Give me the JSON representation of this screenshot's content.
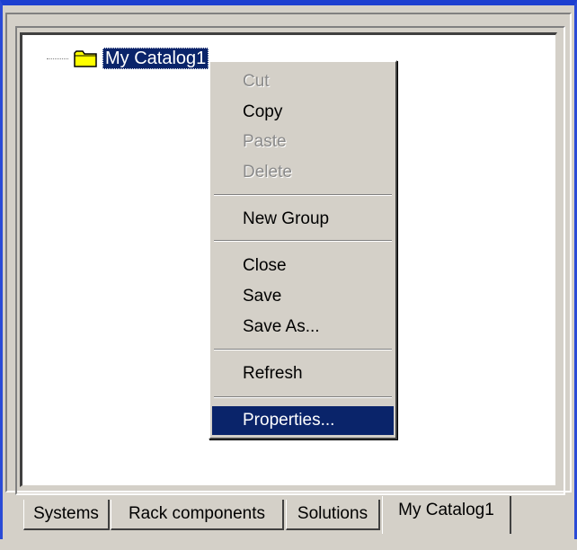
{
  "tree": {
    "root_label": "My Catalog1"
  },
  "context_menu": {
    "items": [
      {
        "label": "Cut",
        "enabled": false
      },
      {
        "label": "Copy",
        "enabled": true
      },
      {
        "label": "Paste",
        "enabled": false
      },
      {
        "label": "Delete",
        "enabled": false
      },
      {
        "label": "New Group",
        "enabled": true
      },
      {
        "label": "Close",
        "enabled": true
      },
      {
        "label": "Save",
        "enabled": true
      },
      {
        "label": "Save As...",
        "enabled": true
      },
      {
        "label": "Refresh",
        "enabled": true
      },
      {
        "label": "Properties...",
        "enabled": true,
        "highlighted": true
      }
    ]
  },
  "tabs": [
    {
      "label": "Systems"
    },
    {
      "label": "Rack components"
    },
    {
      "label": "Solutions"
    },
    {
      "label": "My Catalog1",
      "active": true
    }
  ],
  "colors": {
    "title_bar": "#1c3fd0",
    "selection": "#0a246a",
    "face": "#d4d0c8"
  }
}
